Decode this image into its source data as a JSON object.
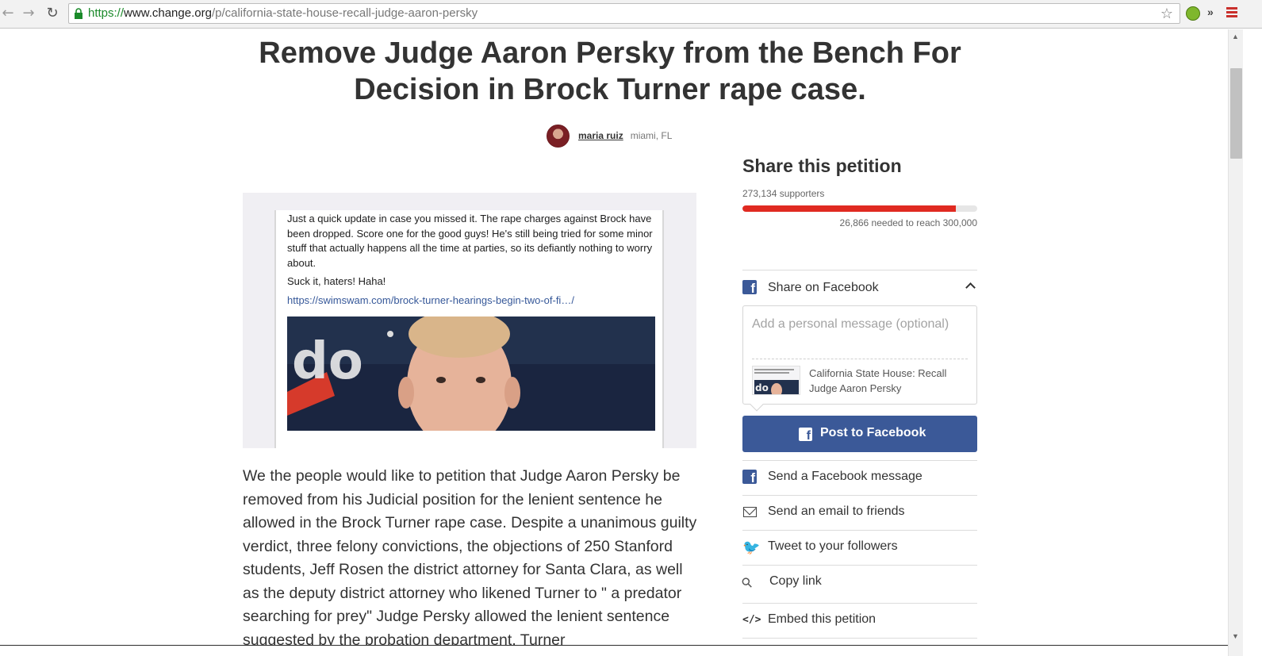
{
  "browser": {
    "url_scheme": "https://",
    "url_host": "www.change.org",
    "url_path": "/p/california-state-house-recall-judge-aaron-persky",
    "icons": [
      "back-icon",
      "forward-icon",
      "reload-icon",
      "lock-icon",
      "star-icon",
      "extension-icon",
      "more-icon",
      "menu-icon"
    ]
  },
  "petition": {
    "title": "Remove Judge Aaron Persky from the Bench For Decision in Brock Turner rape case.",
    "author_name": "maria ruiz",
    "author_location": "miami, FL",
    "media": {
      "post_text": "Just a quick update in case you missed it. The rape charges against Brock have been dropped. Score one for the good guys! He's still being tried for some minor stuff that actually happens all the time at parties, so its defiantly nothing to worry about.",
      "post_text2": "Suck it, haters! Haha!",
      "post_link": "https://swimswam.com/brock-turner-hearings-begin-two-of-fi…/"
    },
    "body": "We the people would like to petition that Judge Aaron Persky be removed from his Judicial position for the lenient sentence he allowed in the Brock Turner rape case. Despite a unanimous guilty verdict, three felony convictions, the objections of 250 Stanford students, Jeff Rosen the district attorney for Santa Clara, as well as the deputy district attorney who likened Turner to \" a predator searching for prey\" Judge Persky allowed the lenient sentence suggested by the probation department. Turner"
  },
  "sidebar": {
    "title": "Share this petition",
    "supporters": "273,134 supporters",
    "progress_fraction": 0.91,
    "needed": "26,866 needed to reach 300,000",
    "facebook_share_label": "Share on Facebook",
    "message_placeholder": "Add a personal message (optional)",
    "preview_title": "California State House: Recall Judge Aaron Persky",
    "post_button": "Post to Facebook",
    "options": {
      "fb_message": "Send a Facebook message",
      "email": "Send an email to friends",
      "tweet": "Tweet to your followers",
      "copy_link": "Copy link",
      "embed": "Embed this petition"
    }
  },
  "colors": {
    "progress": "#e02a21",
    "facebook": "#3b5998",
    "twitter": "#1da1f2"
  }
}
